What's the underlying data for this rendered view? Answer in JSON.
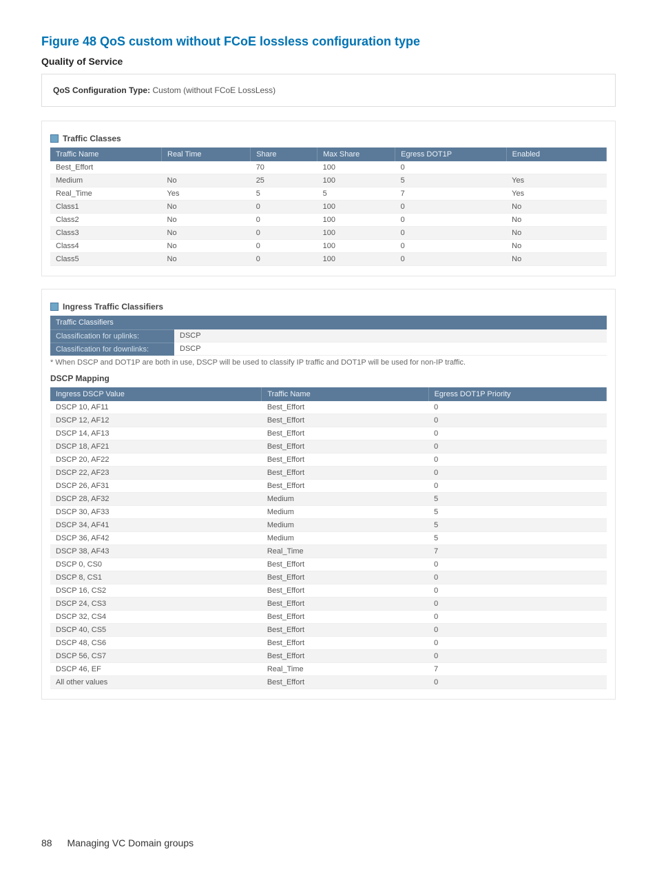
{
  "figure_title": "Figure 48 QoS custom without FCoE lossless configuration type",
  "quality_of_service": "Quality of Service",
  "config_type_label": "QoS Configuration Type:",
  "config_type_value": "Custom (without FCoE LossLess)",
  "traffic_classes": {
    "title": "Traffic Classes",
    "headers": [
      "Traffic Name",
      "Real Time",
      "Share",
      "Max Share",
      "Egress DOT1P",
      "Enabled"
    ],
    "rows": [
      [
        "Best_Effort",
        "",
        "70",
        "100",
        "0",
        ""
      ],
      [
        "Medium",
        "No",
        "25",
        "100",
        "5",
        "Yes"
      ],
      [
        "Real_Time",
        "Yes",
        "5",
        "5",
        "7",
        "Yes"
      ],
      [
        "Class1",
        "No",
        "0",
        "100",
        "0",
        "No"
      ],
      [
        "Class2",
        "No",
        "0",
        "100",
        "0",
        "No"
      ],
      [
        "Class3",
        "No",
        "0",
        "100",
        "0",
        "No"
      ],
      [
        "Class4",
        "No",
        "0",
        "100",
        "0",
        "No"
      ],
      [
        "Class5",
        "No",
        "0",
        "100",
        "0",
        "No"
      ]
    ]
  },
  "ingress_classifiers": {
    "title": "Ingress Traffic Classifiers",
    "box_title": "Traffic Classifiers",
    "uplinks_label": "Classification for uplinks:",
    "uplinks_value": "DSCP",
    "downlinks_label": "Classification for downlinks:",
    "downlinks_value": "DSCP",
    "footnote": "* When DSCP and DOT1P are both in use, DSCP will be used to classify IP traffic and DOT1P will be used for non-IP traffic."
  },
  "dscp_mapping": {
    "title": "DSCP Mapping",
    "headers": [
      "Ingress DSCP Value",
      "Traffic Name",
      "Egress DOT1P Priority"
    ],
    "rows": [
      [
        "DSCP 10, AF11",
        "Best_Effort",
        "0"
      ],
      [
        "DSCP 12, AF12",
        "Best_Effort",
        "0"
      ],
      [
        "DSCP 14, AF13",
        "Best_Effort",
        "0"
      ],
      [
        "DSCP 18, AF21",
        "Best_Effort",
        "0"
      ],
      [
        "DSCP 20, AF22",
        "Best_Effort",
        "0"
      ],
      [
        "DSCP 22, AF23",
        "Best_Effort",
        "0"
      ],
      [
        "DSCP 26, AF31",
        "Best_Effort",
        "0"
      ],
      [
        "DSCP 28, AF32",
        "Medium",
        "5"
      ],
      [
        "DSCP 30, AF33",
        "Medium",
        "5"
      ],
      [
        "DSCP 34, AF41",
        "Medium",
        "5"
      ],
      [
        "DSCP 36, AF42",
        "Medium",
        "5"
      ],
      [
        "DSCP 38, AF43",
        "Real_Time",
        "7"
      ],
      [
        "DSCP 0, CS0",
        "Best_Effort",
        "0"
      ],
      [
        "DSCP 8, CS1",
        "Best_Effort",
        "0"
      ],
      [
        "DSCP 16, CS2",
        "Best_Effort",
        "0"
      ],
      [
        "DSCP 24, CS3",
        "Best_Effort",
        "0"
      ],
      [
        "DSCP 32, CS4",
        "Best_Effort",
        "0"
      ],
      [
        "DSCP 40, CS5",
        "Best_Effort",
        "0"
      ],
      [
        "DSCP 48, CS6",
        "Best_Effort",
        "0"
      ],
      [
        "DSCP 56, CS7",
        "Best_Effort",
        "0"
      ],
      [
        "DSCP 46, EF",
        "Real_Time",
        "7"
      ],
      [
        "All other values",
        "Best_Effort",
        "0"
      ]
    ]
  },
  "footer": {
    "page_number": "88",
    "chapter": "Managing VC Domain groups"
  }
}
